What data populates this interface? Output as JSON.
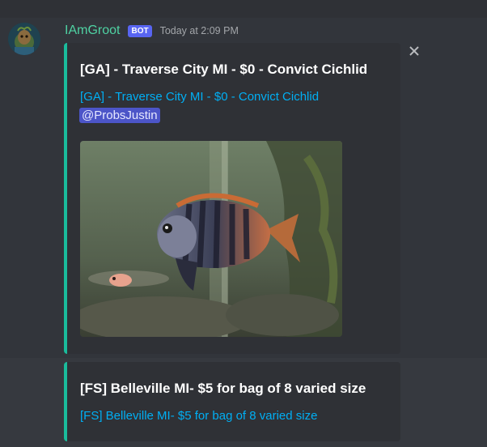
{
  "message": {
    "username": "IAmGroot",
    "bot_tag": "BOT",
    "timestamp": "Today at 2:09 PM"
  },
  "embeds": [
    {
      "title": "[GA] - Traverse City MI - $0 - Convict Cichlid",
      "link_text": "[GA] - Traverse City MI - $0 - Convict Cichlid",
      "mention": "@ProbsJustin",
      "image": "convict-cichlid-aquarium-photo"
    },
    {
      "title": "[FS] Belleville MI- $5 for bag of 8 varied size",
      "link_text": "[FS] Belleville MI- $5 for bag of 8 varied size"
    }
  ],
  "icons": {
    "close": "close-icon",
    "avatar": "groot-avatar"
  },
  "colors": {
    "background": "#36393f",
    "username": "#4fd2a3",
    "bot_tag": "#5865f2",
    "embed_border": "#1abc9c",
    "link": "#00aff4"
  }
}
